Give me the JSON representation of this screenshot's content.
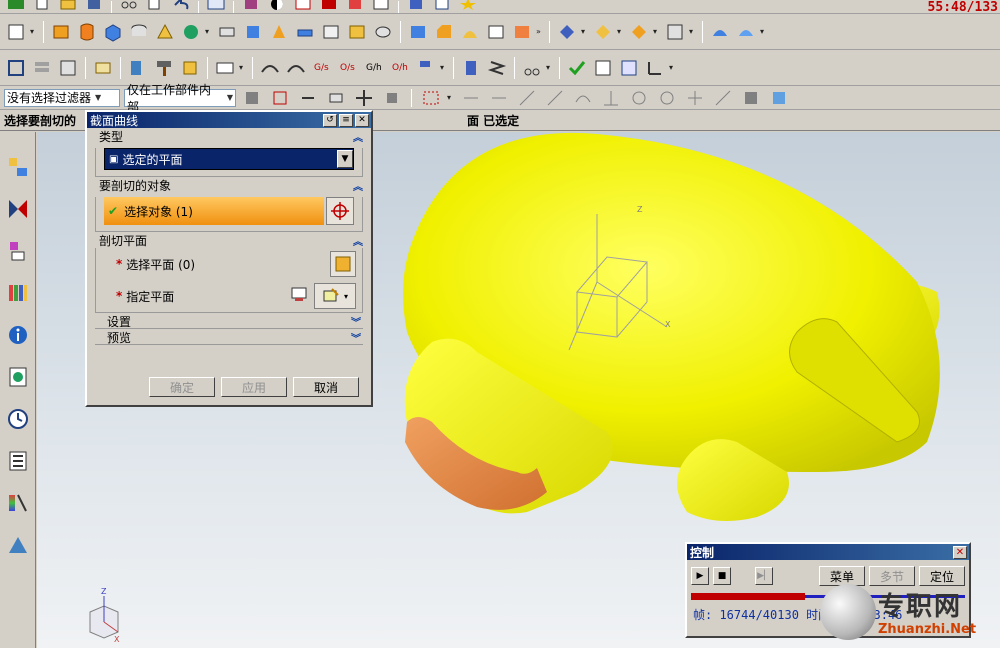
{
  "timer": "55:48/133",
  "toolbar1": {
    "icons": [
      "app-logo-icon",
      "new-file-icon",
      "open-folder-icon",
      "save-icon",
      "cut-icon",
      "copy-icon",
      "undo-icon",
      "window-icon",
      "render-icon",
      "ball-icon",
      "display-icon",
      "shade-icon",
      "flag-icon",
      "paint-icon",
      "dyn-icon",
      "sketch-icon",
      "star-icon"
    ]
  },
  "toolbar2": {
    "icons": [
      "sketch-icon",
      "extrude-icon",
      "revolve-icon",
      "box-icon",
      "cylinder-icon",
      "cone-icon",
      "sphere-icon",
      "hole-icon",
      "boss-icon",
      "pocket-icon",
      "pad-icon",
      "slot-icon",
      "groove-icon",
      "tube-icon",
      "blend-icon",
      "chamfer-icon",
      "shell-icon",
      "offset-icon",
      "draft-icon",
      "trim-icon",
      "split-icon",
      "mirror-icon",
      "pattern-icon",
      "unite-icon",
      "subtract-icon",
      "intersect-icon",
      "surface-icon",
      "sew-icon"
    ]
  },
  "toolbar3": {
    "icons": [
      "view-fit-icon",
      "layers-icon",
      "stack-icon",
      "note-icon",
      "wrench-icon",
      "hammer-icon",
      "cube-icon",
      "abc-icon",
      "curve1-icon",
      "curve2-icon",
      "g-curve-icon",
      "o-curve-icon",
      "g-surface-icon",
      "o-surface-icon",
      "flag-curve-icon",
      "cylinder-icon",
      "spring-icon",
      "scissors-icon",
      "check-icon",
      "table-icon",
      "grid-icon",
      "axis-icon"
    ]
  },
  "filter": {
    "selection_filter": "没有选择过滤器",
    "scope": "仅在工作部件内部"
  },
  "status": {
    "left": "选择要剖切的",
    "middle": "面 已选定"
  },
  "dialog": {
    "title": "截面曲线",
    "type_section": "类型",
    "type_value": "选定的平面",
    "objects_section": "要剖切的对象",
    "select_objects": "选择对象 (1)",
    "plane_section": "剖切平面",
    "select_plane": "选择平面 (0)",
    "specify_plane": "指定平面",
    "settings": "设置",
    "preview": "预览",
    "ok": "确定",
    "apply": "应用",
    "cancel": "取消"
  },
  "control": {
    "title": "控制",
    "menu": "菜单",
    "section": "多节",
    "locate": "定位",
    "frame": "帧: 16744/40130 时间: 07:33:46",
    "progress_fraction": 0.416
  },
  "watermark": {
    "cn": "专职网",
    "url": "Zhuanzhi.Net"
  }
}
